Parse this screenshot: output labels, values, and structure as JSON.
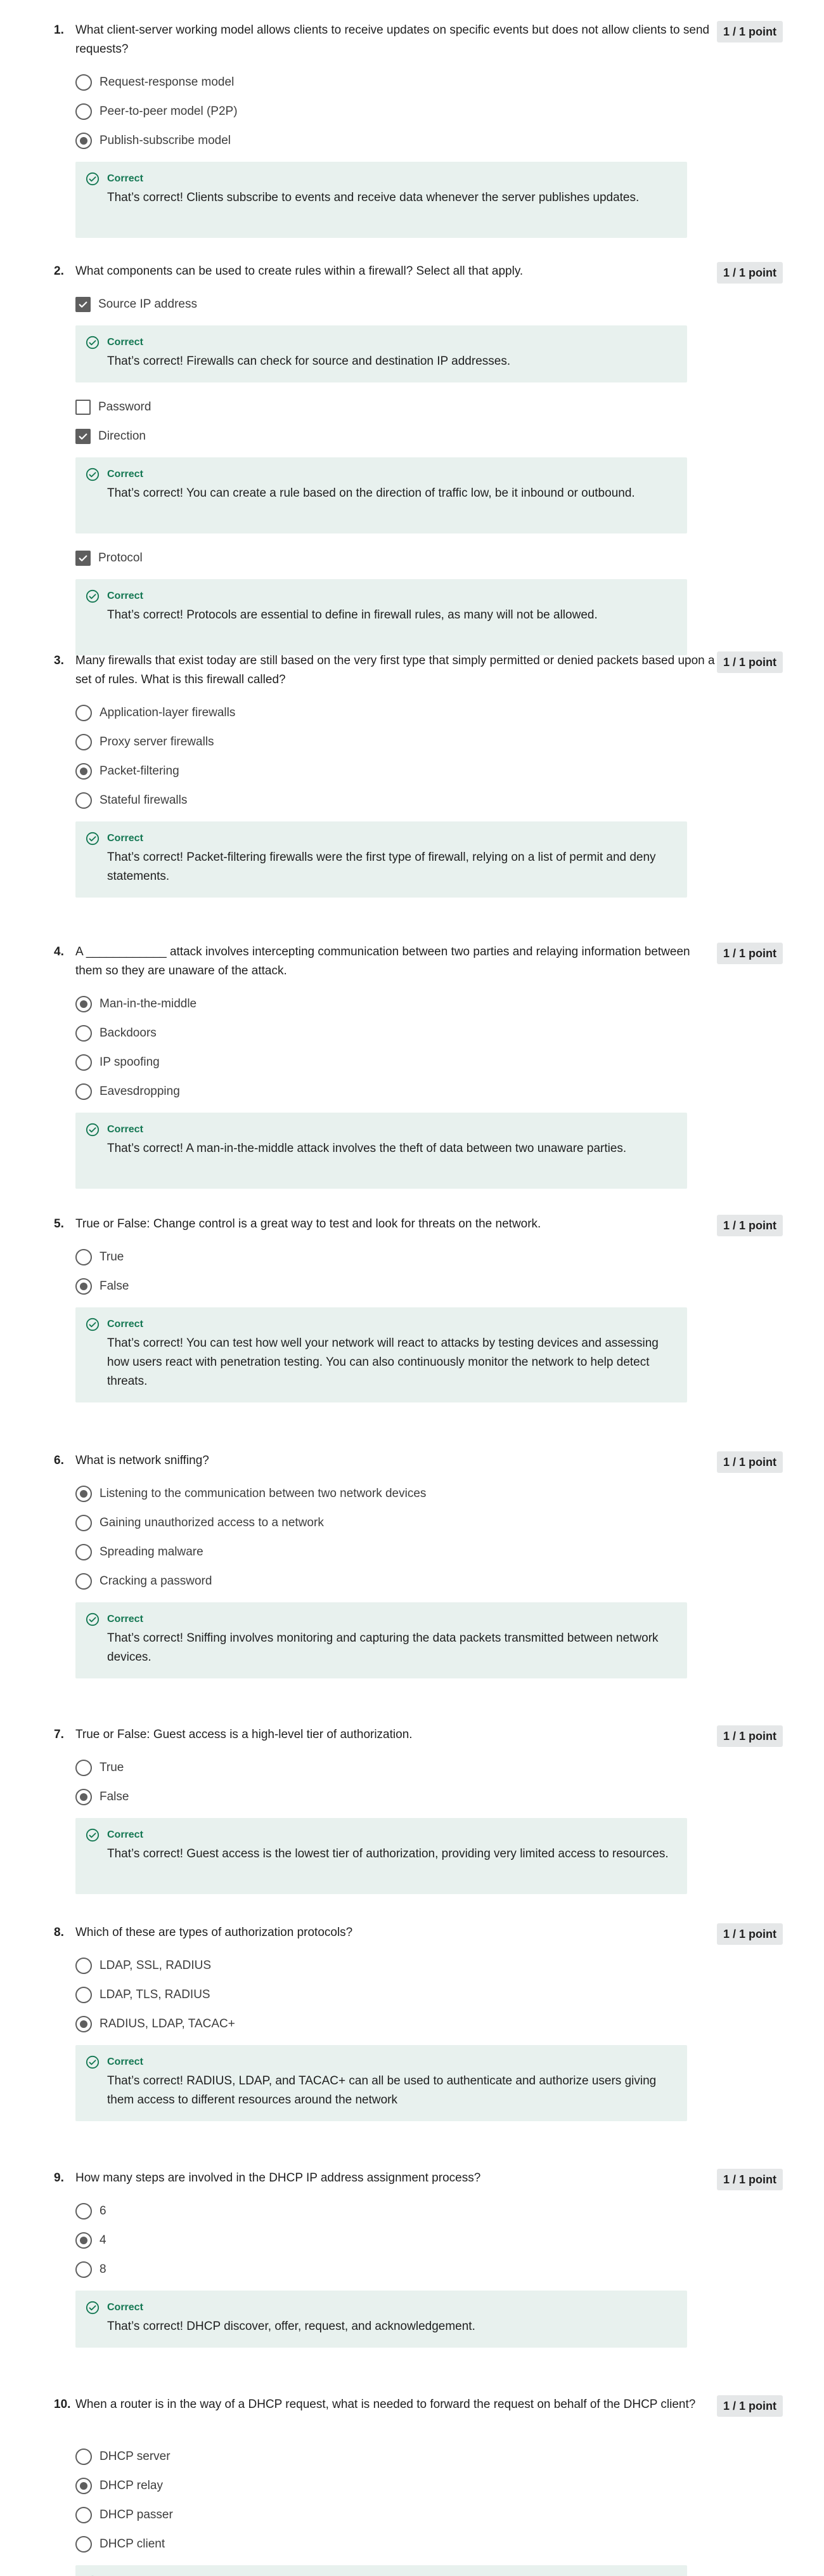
{
  "colors": {
    "correct_green": "#137752",
    "feedback_bg": "#e8f1ee",
    "points_bg": "#e5e7e8",
    "control_gray": "#5e5e5e"
  },
  "feedback_icon": "check-circle-icon",
  "correct_label": "Correct",
  "questions": [
    {
      "number": "1.",
      "text": "What client-server working model allows clients to receive updates on specific events but does not allow clients to send requests?",
      "points": "1 / 1 point",
      "type": "radio",
      "options": [
        {
          "label": "Request-response model",
          "selected": false
        },
        {
          "label": "Peer-to-peer model (P2P)",
          "selected": false
        },
        {
          "label": "Publish-subscribe model",
          "selected": true
        }
      ],
      "feedback": [
        {
          "after": 2,
          "text": "That’s correct! Clients subscribe to events and receive data whenever the server publishes updates."
        }
      ]
    },
    {
      "number": "2.",
      "text": "What components can be used to create rules within a firewall? Select all that apply.",
      "points": "1 / 1 point",
      "type": "checkbox",
      "options": [
        {
          "label": "Source IP address",
          "selected": true
        },
        {
          "label": "Password",
          "selected": false
        },
        {
          "label": "Direction",
          "selected": true
        },
        {
          "label": "Protocol",
          "selected": true
        }
      ],
      "feedback": [
        {
          "after": 0,
          "text": "That’s correct! Firewalls can check for source and destination IP addresses."
        },
        {
          "after": 2,
          "text": "That’s correct! You can create a rule based on the direction of traffic low, be it inbound or outbound."
        },
        {
          "after": 3,
          "text": "That’s correct! Protocols are essential to define in firewall rules, as many will not be allowed."
        }
      ]
    },
    {
      "number": "3.",
      "text": "Many firewalls that exist today are still based on the very first type that simply permitted or denied packets based upon a set of rules. What is this firewall called?",
      "points": "1 / 1 point",
      "type": "radio",
      "options": [
        {
          "label": "Application-layer firewalls",
          "selected": false
        },
        {
          "label": "Proxy server firewalls",
          "selected": false
        },
        {
          "label": "Packet-filtering",
          "selected": true
        },
        {
          "label": "Stateful firewalls",
          "selected": false
        }
      ],
      "feedback": [
        {
          "after": 3,
          "text": "That’s correct! Packet-filtering firewalls were the first type of firewall, relying on a list of permit and deny statements."
        }
      ]
    },
    {
      "number": "4.",
      "text": "A ____________ attack involves intercepting communication between two parties and relaying information between them so they are unaware of the attack.",
      "points": "1 / 1 point",
      "type": "radio",
      "options": [
        {
          "label": "Man-in-the-middle",
          "selected": true
        },
        {
          "label": "Backdoors",
          "selected": false
        },
        {
          "label": "IP spoofing",
          "selected": false
        },
        {
          "label": "Eavesdropping",
          "selected": false
        }
      ],
      "feedback": [
        {
          "after": 3,
          "text": "That’s correct! A man-in-the-middle attack involves the theft of data between two unaware parties."
        }
      ]
    },
    {
      "number": "5.",
      "text": "True or False: Change control is a great way to test and look for threats on the network.",
      "points": "1 / 1 point",
      "type": "radio",
      "options": [
        {
          "label": "True",
          "selected": false
        },
        {
          "label": "False",
          "selected": true
        }
      ],
      "feedback": [
        {
          "after": 1,
          "text": "That’s correct! You can test how well your network will react to attacks by testing devices and assessing how users react with penetration testing. You can also continuously monitor the network to help detect threats."
        }
      ]
    },
    {
      "number": "6.",
      "text": "What is network sniffing?",
      "points": "1 / 1 point",
      "type": "radio",
      "options": [
        {
          "label": "Listening to the communication between two network devices",
          "selected": true
        },
        {
          "label": "Gaining unauthorized access to a network",
          "selected": false
        },
        {
          "label": "Spreading malware",
          "selected": false
        },
        {
          "label": "Cracking a password",
          "selected": false
        }
      ],
      "feedback": [
        {
          "after": 3,
          "text": "That’s correct! Sniffing involves monitoring and capturing the data packets transmitted between network devices."
        }
      ]
    },
    {
      "number": "7.",
      "text": "True or False: Guest access is a high-level tier of authorization.",
      "points": "1 / 1 point",
      "type": "radio",
      "options": [
        {
          "label": "True",
          "selected": false
        },
        {
          "label": "False",
          "selected": true
        }
      ],
      "feedback": [
        {
          "after": 1,
          "text": "That’s correct! Guest access is the lowest tier of authorization, providing very limited access to resources."
        }
      ]
    },
    {
      "number": "8.",
      "text": "Which of these are types of authorization protocols?",
      "points": "1 / 1 point",
      "type": "radio",
      "options": [
        {
          "label": "LDAP, SSL, RADIUS",
          "selected": false
        },
        {
          "label": "LDAP, TLS, RADIUS",
          "selected": false
        },
        {
          "label": "RADIUS, LDAP, TACAC+",
          "selected": true
        }
      ],
      "feedback": [
        {
          "after": 2,
          "text": "That’s correct! RADIUS, LDAP, and TACAC+ can all be used to authenticate and authorize users giving them access to different resources around the network"
        }
      ]
    },
    {
      "number": "9.",
      "text": "How many steps are involved in the DHCP IP address assignment process?",
      "points": "1 / 1 point",
      "type": "radio",
      "options": [
        {
          "label": "6",
          "selected": false
        },
        {
          "label": "4",
          "selected": true
        },
        {
          "label": "8",
          "selected": false
        }
      ],
      "feedback": [
        {
          "after": 2,
          "text": "That’s correct! DHCP discover, offer, request, and acknowledgement."
        }
      ]
    },
    {
      "number": "10.",
      "text": "When a router is in the way of a DHCP request, what is needed to forward the request on behalf of the DHCP client?",
      "points": "1 / 1 point",
      "type": "radio",
      "options": [
        {
          "label": "DHCP server",
          "selected": false
        },
        {
          "label": "DHCP relay",
          "selected": true
        },
        {
          "label": "DHCP passer",
          "selected": false
        },
        {
          "label": "DHCP client",
          "selected": false
        }
      ],
      "feedback": [
        {
          "after": 3,
          "text": ""
        }
      ]
    }
  ]
}
